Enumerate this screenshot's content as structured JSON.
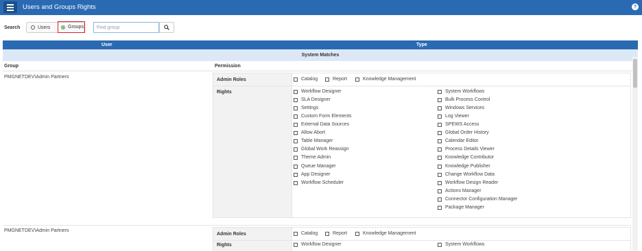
{
  "header": {
    "title": "Users and Groups Rights",
    "help_glyph": "?"
  },
  "search": {
    "label": "Search",
    "options": [
      {
        "label": "Users",
        "selected": false
      },
      {
        "label": "Groups",
        "selected": true
      }
    ],
    "placeholder": "Find group",
    "value": ""
  },
  "table": {
    "header_user": "User",
    "header_type": "Type",
    "section": "System Matches",
    "col_group": "Group",
    "col_permission": "Permission"
  },
  "groups": [
    {
      "name": "PMGNETDEV\\Admin Partners",
      "admin_roles_label": "Admin Roles",
      "admin_roles": [
        "Catalog",
        "Report",
        "Knowledge Management"
      ],
      "rights_label": "Rights",
      "rights_col1": [
        "Workflow Designer",
        "SLA Designer",
        "Settings",
        "Custom Form Elements",
        "External Data Sources",
        "Allow Abort",
        "Table Manager",
        "Global Work Reassign",
        "Theme Admin",
        "Queue Manager",
        "App Designer",
        "Workflow Scheduler"
      ],
      "rights_col2": [
        "System Workflows",
        "Bulk Process Control",
        "Windows Services",
        "Log Viewer",
        "SPEWS Access",
        "Global Order History",
        "Calendar Editor",
        "Process Details Viewer",
        "Knowledge Contributor",
        "Knowledge Publisher",
        "Change Workflow Data",
        "Workflow Design Reader",
        "Actions Manager",
        "Connector Configuration Manager",
        "Package Manager"
      ]
    },
    {
      "name": "PMGNETDEV\\Admin Partners",
      "admin_roles_label": "Admin Roles",
      "admin_roles": [
        "Catalog",
        "Report",
        "Knowledge Management"
      ],
      "rights_label": "Rights",
      "rights_col1": [
        "Workflow Designer"
      ],
      "rights_col2": [
        "System Workflows"
      ]
    }
  ],
  "colors": {
    "brand": "#2a6ab3",
    "section_bg": "#dde8f7",
    "highlight": "#d9242b",
    "selected_radio": "#46a049"
  }
}
